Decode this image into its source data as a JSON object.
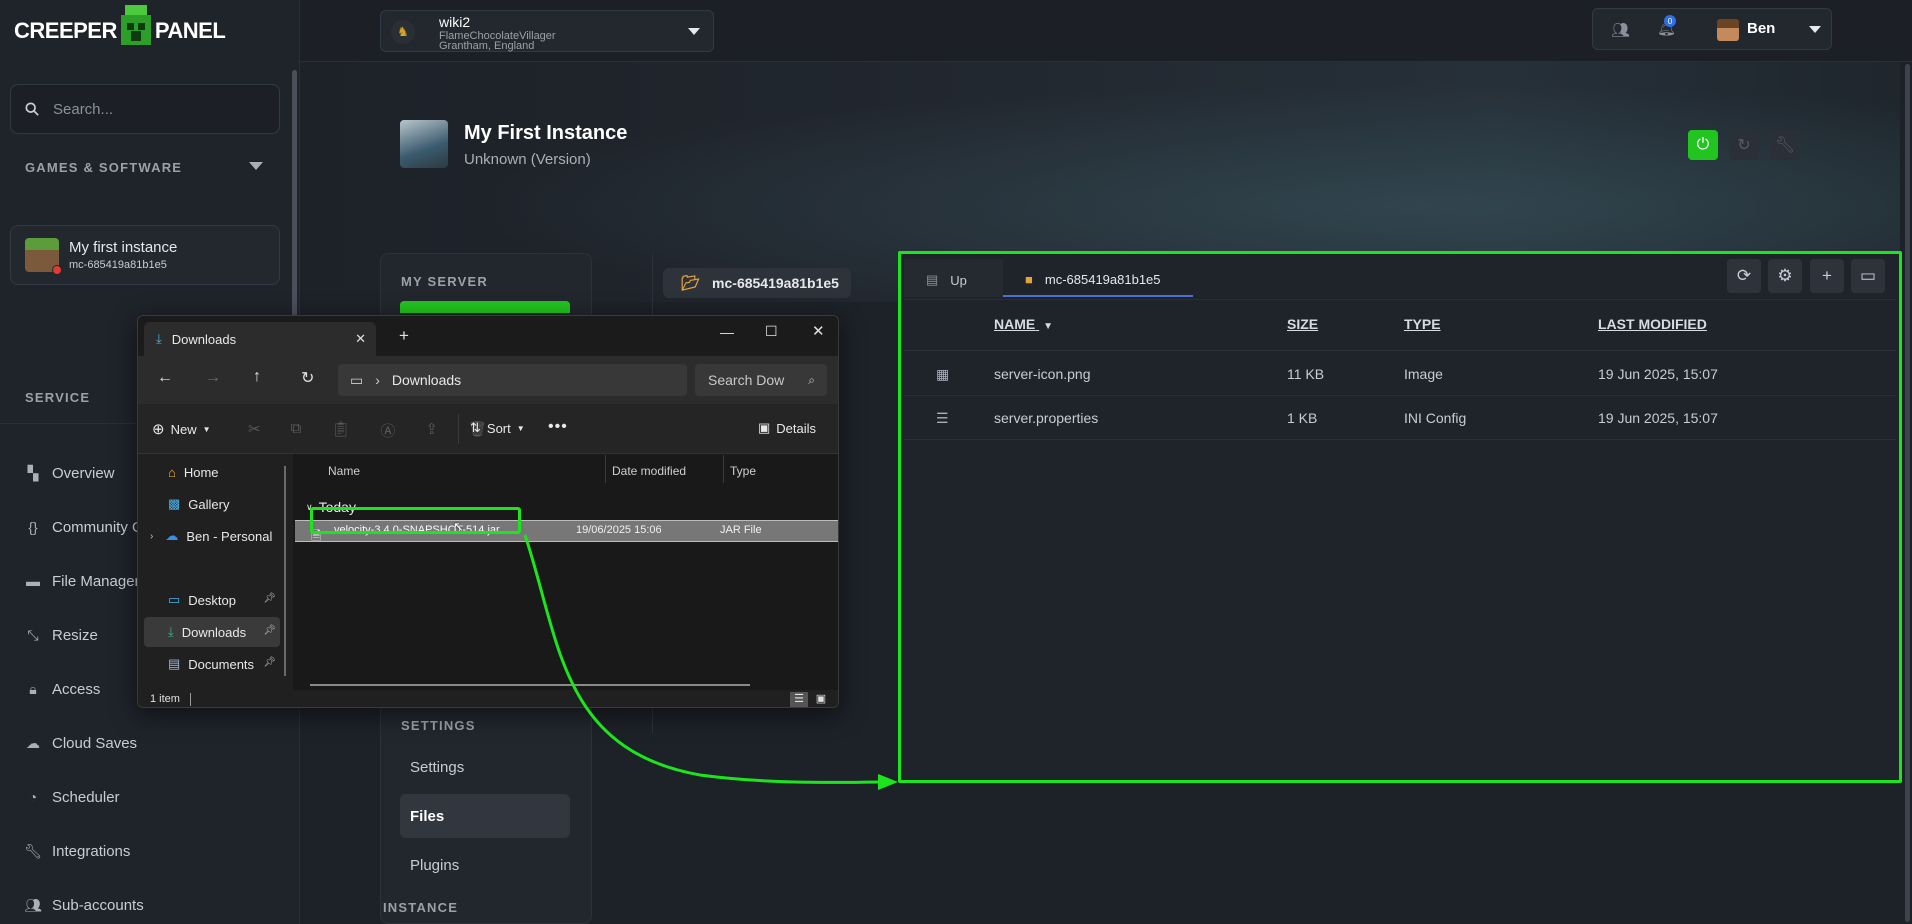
{
  "brand": {
    "left": "CREEPER",
    "right": "PANEL"
  },
  "sidebar": {
    "search_placeholder": "Search...",
    "games_section": "GAMES & SOFTWARE",
    "instance_name": "My first instance",
    "instance_id": "mc-685419a81b1e5",
    "service_section": "SERVICE",
    "items": [
      {
        "label": "Overview",
        "icon": "overview-icon"
      },
      {
        "label": "Community G",
        "icon": "braces-icon"
      },
      {
        "label": "File Manager",
        "icon": "folder-icon"
      },
      {
        "label": "Resize",
        "icon": "resize-icon"
      },
      {
        "label": "Access",
        "icon": "lock-icon"
      },
      {
        "label": "Cloud Saves",
        "icon": "cloud-icon"
      },
      {
        "label": "Scheduler",
        "icon": "clock-icon"
      },
      {
        "label": "Integrations",
        "icon": "wrench-icon"
      },
      {
        "label": "Sub-accounts",
        "icon": "users-icon"
      }
    ]
  },
  "topbar": {
    "server_name": "wiki2",
    "server_host": "FlameChocolateVillager",
    "server_location": "Grantham, England",
    "notification_count": "0",
    "user_name": "Ben"
  },
  "instance": {
    "title": "My First Instance",
    "version": "Unknown (Version)"
  },
  "server_menu": {
    "heading": "MY SERVER",
    "settings_heading": "SETTINGS",
    "instance_heading": "INSTANCE",
    "links": [
      "Settings",
      "Files",
      "Plugins"
    ]
  },
  "path_pill": "mc-685419a81b1e5",
  "file_manager": {
    "tabs": [
      "Up",
      "mc-685419a81b1e5"
    ],
    "columns": [
      "NAME",
      "SIZE",
      "TYPE",
      "LAST MODIFIED"
    ],
    "rows": [
      {
        "name": "server-icon.png",
        "size": "11 KB",
        "type": "Image",
        "modified": "19 Jun 2025, 15:07",
        "icon": "file-image-icon"
      },
      {
        "name": "server.properties",
        "size": "1 KB",
        "type": "INI Config",
        "modified": "19 Jun 2025, 15:07",
        "icon": "settings-sliders-icon"
      }
    ]
  },
  "explorer": {
    "tab_title": "Downloads",
    "address": "Downloads",
    "search_placeholder": "Search Dow",
    "new_label": "New",
    "sort_label": "Sort",
    "details_label": "Details",
    "nav": [
      "Home",
      "Gallery",
      "Ben - Personal",
      "Desktop",
      "Downloads",
      "Documents"
    ],
    "columns": [
      "Name",
      "Date modified",
      "Type"
    ],
    "group": "Today",
    "file": {
      "name": "velocity-3.4.0-SNAPSHOT-514.jar",
      "date": "19/06/2025 15:06",
      "type": "JAR File"
    },
    "status": "1 item"
  },
  "colors": {
    "accent_green": "#1de51d",
    "power_green": "#22c41f",
    "bg": "#1d2128"
  }
}
